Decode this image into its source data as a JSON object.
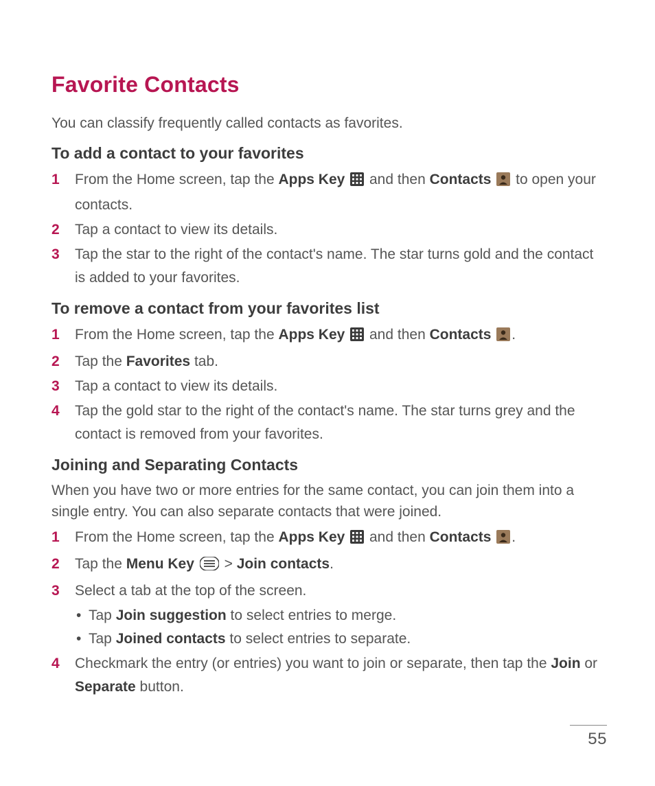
{
  "title": "Favorite Contacts",
  "intro": "You can classify frequently called contacts as favorites.",
  "section_add": {
    "heading": "To add a contact to your favorites",
    "step1_a": "From the Home screen, tap the ",
    "apps_key": "Apps Key",
    "step1_b": " and then ",
    "contacts": "Contacts",
    "step1_c": " to open your contacts.",
    "step2": "Tap a contact to view its details.",
    "step3": "Tap the star to the right of the contact's name. The star turns gold and the contact is added to your favorites."
  },
  "section_remove": {
    "heading": "To remove a contact from your favorites list",
    "step1_a": "From the Home screen, tap the ",
    "apps_key": "Apps Key",
    "step1_b": " and then ",
    "contacts": "Contacts",
    "step1_c": ".",
    "step2_a": "Tap the ",
    "favorites": "Favorites",
    "step2_b": " tab.",
    "step3": "Tap a contact to view its details.",
    "step4": "Tap the gold star to the right of the contact's name. The star turns grey and the contact is removed from your favorites."
  },
  "section_join": {
    "heading": "Joining and Separating Contacts",
    "intro": "When you have two or more entries for the same contact, you can join them into a single entry. You can also separate contacts that were joined.",
    "step1_a": "From the Home screen, tap the ",
    "apps_key": "Apps Key",
    "step1_b": " and then ",
    "contacts": "Contacts",
    "step1_c": ".",
    "step2_a": "Tap the ",
    "menu_key": "Menu Key",
    "step2_b": " > ",
    "join_contacts": "Join contacts",
    "step2_c": ".",
    "step3": "Select a tab at the top of the screen.",
    "bullet1_a": "Tap ",
    "bullet1_b": "Join suggestion",
    "bullet1_c": " to select entries to merge.",
    "bullet2_a": "Tap ",
    "bullet2_b": "Joined contacts",
    "bullet2_c": " to select entries to separate.",
    "step4_a": "Checkmark the entry (or entries) you want to join or separate, then tap the ",
    "join": "Join",
    "step4_b": " or ",
    "separate": "Separate",
    "step4_c": " button."
  },
  "page_number": "55"
}
